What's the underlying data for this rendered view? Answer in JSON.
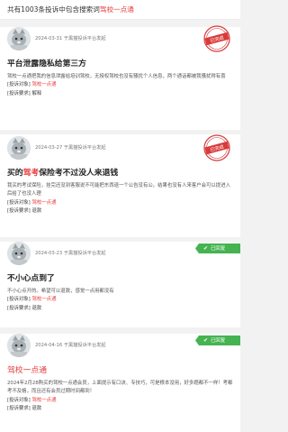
{
  "header": {
    "prefix": "共有1003条投诉中包含搜索词",
    "keyword": "驾校一点通"
  },
  "complaints": [
    {
      "date_text": "2024-03-31",
      "platform_text": "于黑猫投诉平台发起",
      "status": "已完成",
      "status_type": "stamp",
      "title_parts": [
        "平台泄露隐私给第三方"
      ],
      "body": "驾校一点通把我的信息泄露给培训驾校，无授权驾校也没有骚扰个人信息，两个通话都被我骚扰得有喜",
      "target_label": "[投诉对象]",
      "target_value": "驾校一点通",
      "demand_label": "[投诉要求]",
      "demand_value": "解释"
    },
    {
      "date_text": "2024-03-27",
      "platform_text": "于黑猫投诉平台发起",
      "status": "已完成",
      "status_type": "stamp",
      "title_parts": [
        "买的",
        "驾考",
        "保险考不过没人来退钱"
      ],
      "body": "我买的考试保险，挂完还没到客服说不可能把东西退一个公告没有公。结果也没有人来客户会可以提进入后给了也没人理",
      "target_label": "[投诉对象]",
      "target_value": "驾校一点通",
      "demand_label": "[投诉要求]",
      "demand_value": "退款"
    },
    {
      "date_text": "2024-03-23",
      "platform_text": "于黑猫投诉平台发起",
      "status": "已回复",
      "status_type": "badge",
      "title_parts": [
        "不小心点到了"
      ],
      "body": "不小心点开的。希望可以退款，感觉一点用都没有",
      "target_label": "[投诉对象]",
      "target_value": "驾校一点通",
      "demand_label": "[投诉要求]",
      "demand_value": "退款"
    },
    {
      "date_text": "2024-04-16",
      "platform_text": "于黑猫投诉平台发起",
      "status": "已回复",
      "status_type": "badge",
      "title_parts": [
        "驾校一点通"
      ],
      "body": "2024年2月28购买的驾校一点通会员，上面提示有口诀、专技巧，可是根本没用，好多题都不一样！考都考不及格，而且还有会员过期时间都到！",
      "target_label": "[投诉对象]",
      "target_value": "驾校一点通",
      "demand_label": "[投诉要求]",
      "demand_value": "退款"
    }
  ],
  "colors": {
    "accent": "#e83a3a",
    "badge_green": "#45b351"
  },
  "icons": {
    "avatar": "cat-avatar-icon",
    "check": "check-icon",
    "stamp": "completed-stamp-icon"
  }
}
